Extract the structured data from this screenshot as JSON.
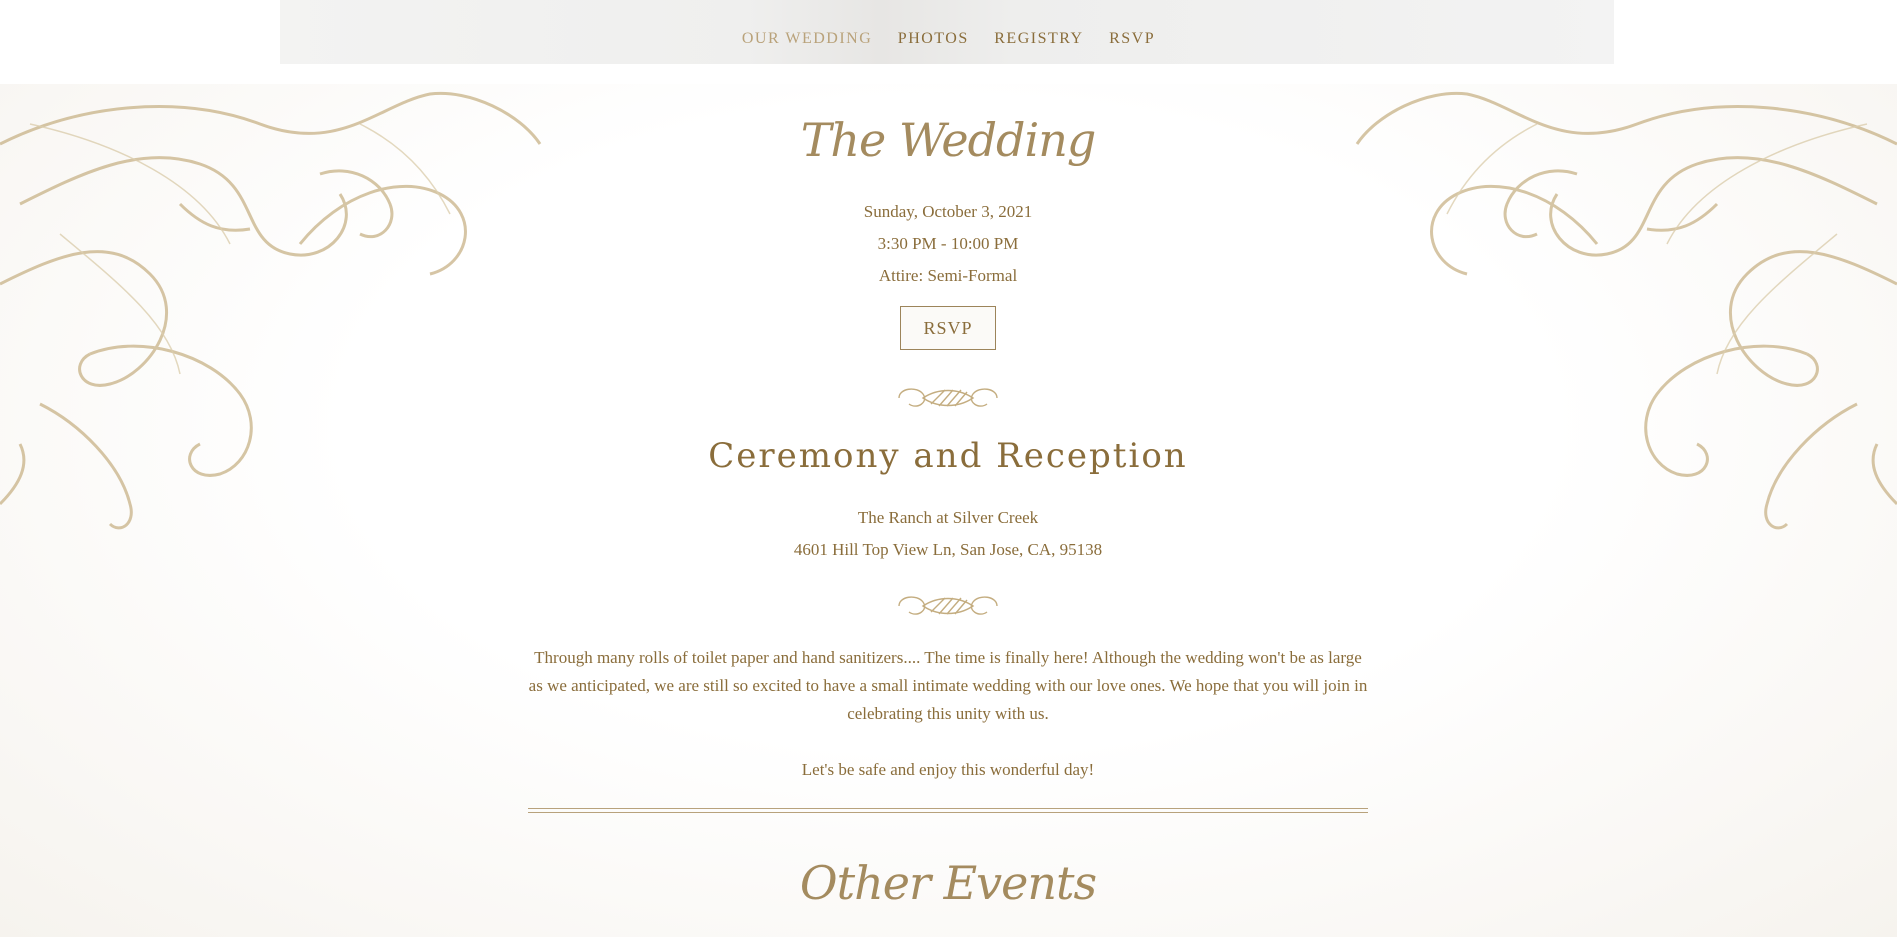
{
  "nav": {
    "items": [
      {
        "label": "OUR WEDDING"
      },
      {
        "label": "PHOTOS"
      },
      {
        "label": "REGISTRY"
      },
      {
        "label": "RSVP"
      }
    ]
  },
  "wedding": {
    "title": "The Wedding",
    "date": "Sunday, October 3, 2021",
    "time": "3:30 PM - 10:00 PM",
    "attire": "Attire: Semi-Formal",
    "rsvp_label": "RSVP"
  },
  "ceremony": {
    "heading": "Ceremony and Reception",
    "venue": "The Ranch at Silver Creek",
    "address": "4601 Hill Top View Ln, San Jose, CA, 95138"
  },
  "message": {
    "paragraph": "Through many rolls of toilet paper and hand sanitizers.... The time is finally here! Although the wedding won't be as large as we anticipated, we are still so excited to have a small intimate wedding with our love ones. We hope that you will join in celebrating this unity with us.",
    "closing": "Let's be safe and enjoy this wonderful day!"
  },
  "other_events": {
    "title": "Other Events"
  },
  "colors": {
    "accent": "#8a6d3b",
    "nav_active": "#b9a27a",
    "ornament_gold": "#c9b48a"
  }
}
